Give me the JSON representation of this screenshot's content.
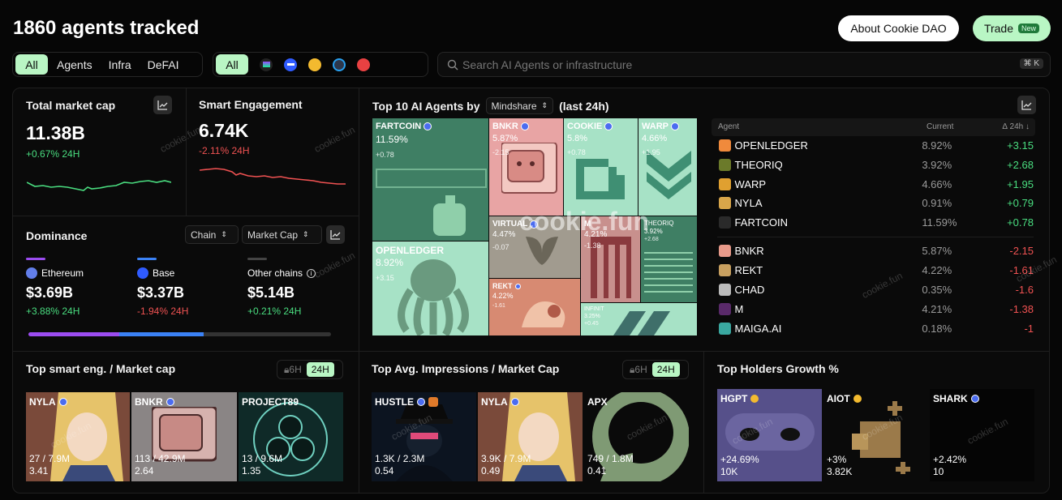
{
  "header": {
    "title": "1860 agents tracked",
    "about_label": "About Cookie DAO",
    "trade_label": "Trade",
    "new_badge": "New"
  },
  "filters": {
    "category": [
      "All",
      "Agents",
      "Infra",
      "DeFAI"
    ],
    "chain_all": "All"
  },
  "search": {
    "placeholder": "Search AI Agents or infrastructure",
    "shortcut": "⌘ K"
  },
  "market_cap": {
    "label": "Total market cap",
    "value": "11.38B",
    "change": "+0.67% 24H"
  },
  "engagement": {
    "label": "Smart Engagement",
    "value": "6.74K",
    "change": "-2.11% 24H"
  },
  "dominance": {
    "label": "Dominance",
    "chain_select": "Chain",
    "metric_select": "Market Cap",
    "items": [
      {
        "name": "Ethereum",
        "value": "$3.69B",
        "change": "+3.88% 24H"
      },
      {
        "name": "Base",
        "value": "$3.37B",
        "change": "-1.94% 24H"
      },
      {
        "name": "Other chains",
        "value": "$5.14B",
        "change": "+0.21% 24H"
      }
    ],
    "bar": [
      0.3,
      0.28,
      0.42
    ]
  },
  "top10": {
    "title_prefix": "Top 10 AI Agents by",
    "metric": "Mindshare",
    "title_suffix": "(last 24h)",
    "tiles": [
      {
        "name": "FARTCOIN",
        "pct": "11.59%",
        "chg": "+0.78"
      },
      {
        "name": "BNKR",
        "pct": "5.87%",
        "chg": "-2.15"
      },
      {
        "name": "COOKIE",
        "pct": "5.8%",
        "chg": "+0.78"
      },
      {
        "name": "WARP",
        "pct": "4.66%",
        "chg": "+1.95"
      },
      {
        "name": "OPENLEDGER",
        "pct": "8.92%",
        "chg": "+3.15"
      },
      {
        "name": "VIRTUAL",
        "pct": "4.47%",
        "chg": "-0.07"
      },
      {
        "name": "M",
        "pct": "4.21%",
        "chg": "-1.38"
      },
      {
        "name": "THEORIQ",
        "pct": "3.92%",
        "chg": "+2.68"
      },
      {
        "name": "REKT",
        "pct": "4.22%",
        "chg": "-1.61"
      },
      {
        "name": "INFINIT",
        "pct": "3.25%",
        "chg": "+0.45"
      }
    ]
  },
  "table": {
    "col_agent": "Agent",
    "col_current": "Current",
    "col_delta": "∆ 24h ↓",
    "rows": [
      {
        "name": "OPENLEDGER",
        "current": "8.92%",
        "delta": "+3.15"
      },
      {
        "name": "THEORIQ",
        "current": "3.92%",
        "delta": "+2.68"
      },
      {
        "name": "WARP",
        "current": "4.66%",
        "delta": "+1.95"
      },
      {
        "name": "NYLA",
        "current": "0.91%",
        "delta": "+0.79"
      },
      {
        "name": "FARTCOIN",
        "current": "11.59%",
        "delta": "+0.78"
      },
      {
        "name": "BNKR",
        "current": "5.87%",
        "delta": "-2.15"
      },
      {
        "name": "REKT",
        "current": "4.22%",
        "delta": "-1.61"
      },
      {
        "name": "CHAD",
        "current": "0.35%",
        "delta": "-1.6"
      },
      {
        "name": "M",
        "current": "4.21%",
        "delta": "-1.38"
      },
      {
        "name": "MAIGA.AI",
        "current": "0.18%",
        "delta": "-1"
      }
    ]
  },
  "sections": {
    "smart_eng": {
      "title": "Top smart eng. / Market cap",
      "tf": [
        "6H",
        "24H"
      ],
      "cards": [
        {
          "name": "NYLA",
          "v1": "27 / 7.9M",
          "v2": "3.41"
        },
        {
          "name": "BNKR",
          "v1": "113 / 42.9M",
          "v2": "2.64"
        },
        {
          "name": "PROJECT89",
          "v1": "13 / 9.6M",
          "v2": "1.35"
        }
      ]
    },
    "impressions": {
      "title": "Top Avg. Impressions / Market Cap",
      "tf": [
        "6H",
        "24H"
      ],
      "cards": [
        {
          "name": "HUSTLE",
          "v1": "1.3K / 2.3M",
          "v2": "0.54"
        },
        {
          "name": "NYLA",
          "v1": "3.9K / 7.9M",
          "v2": "0.49"
        },
        {
          "name": "APX",
          "v1": "749 / 1.8M",
          "v2": "0.41"
        }
      ]
    },
    "holders": {
      "title": "Top Holders Growth %",
      "cards": [
        {
          "name": "HGPT",
          "v1": "+24.69%",
          "v2": "10K"
        },
        {
          "name": "AIOT",
          "v1": "+3%",
          "v2": "3.82K"
        },
        {
          "name": "SHARK",
          "v1": "+2.42%",
          "v2": "10"
        }
      ]
    }
  },
  "watermark": "cookie.fun",
  "colors": {
    "accent": "#b9f6c4",
    "up": "#4ade80",
    "down": "#f05252"
  }
}
